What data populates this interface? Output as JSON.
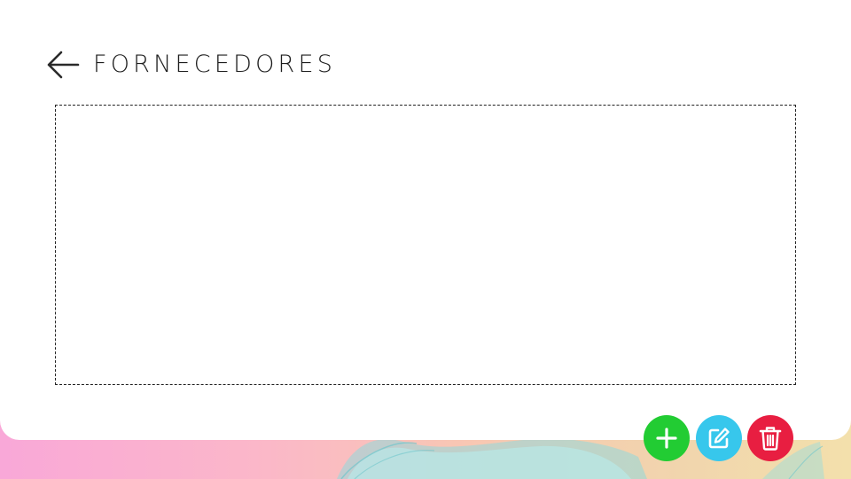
{
  "page": {
    "title": "FORNECEDORES"
  },
  "header": {
    "back_icon": "arrow-left-icon"
  },
  "actions": [
    {
      "name": "add",
      "icon": "plus-icon",
      "color": "#22cc33"
    },
    {
      "name": "edit",
      "icon": "edit-icon",
      "color": "#37c7ec"
    },
    {
      "name": "delete",
      "icon": "trash-icon",
      "color": "#e81e41"
    }
  ],
  "colors": {
    "card": "#ffffff",
    "text": "#1e1e1e",
    "border": "#222222",
    "gradient_left": "#f9a8d8",
    "gradient_right": "#f3e0ac"
  }
}
